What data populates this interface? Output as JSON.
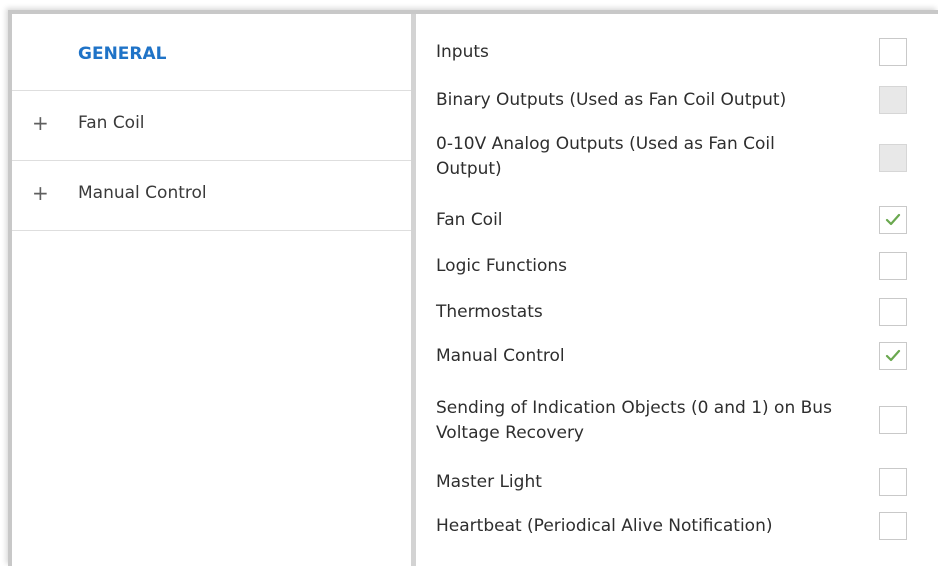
{
  "sidebar": {
    "title": "GENERAL",
    "items": [
      {
        "icon": "plus-icon",
        "label": "Fan Coil"
      },
      {
        "icon": "plus-icon",
        "label": "Manual Control"
      }
    ]
  },
  "options": [
    {
      "label": "Inputs",
      "state": "unchecked"
    },
    {
      "label": "Binary Outputs (Used as Fan Coil Output)",
      "state": "disabled"
    },
    {
      "label": "0-10V Analog Outputs (Used as Fan Coil Output)",
      "state": "disabled"
    },
    {
      "label": "Fan Coil",
      "state": "checked"
    },
    {
      "label": "Logic Functions",
      "state": "unchecked"
    },
    {
      "label": "Thermostats",
      "state": "unchecked"
    },
    {
      "label": "Manual Control",
      "state": "checked"
    },
    {
      "label": "Sending of Indication Objects (0 and 1) on Bus Voltage Recovery",
      "state": "unchecked"
    },
    {
      "label": "Master Light",
      "state": "unchecked"
    },
    {
      "label": "Heartbeat (Periodical Alive Notification)",
      "state": "unchecked"
    }
  ],
  "colors": {
    "title_blue": "#1f73c7",
    "checkmark_green": "#6aa84f"
  }
}
